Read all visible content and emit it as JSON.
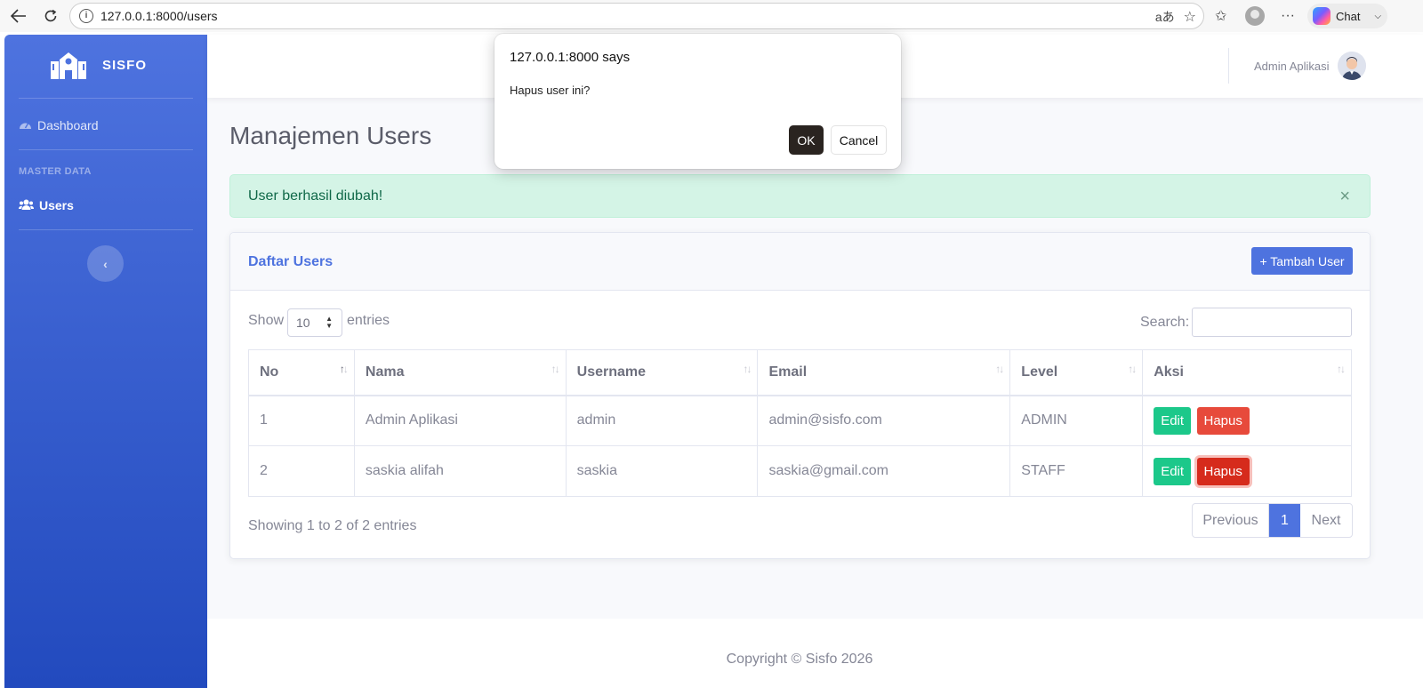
{
  "browser": {
    "url": "127.0.0.1:8000/users",
    "chat_label": "Chat"
  },
  "sidebar": {
    "brand": "SISFO",
    "items": [
      {
        "label": "Dashboard",
        "icon": "tachometer-icon"
      },
      {
        "label": "Users",
        "icon": "users-icon"
      }
    ],
    "heading": "MASTER DATA",
    "toggle_symbol": "‹"
  },
  "topbar": {
    "user_name": "Admin Aplikasi"
  },
  "page": {
    "title": "Manajemen Users"
  },
  "alert": {
    "message": "User berhasil diubah!",
    "close": "×"
  },
  "card": {
    "title": "Daftar Users",
    "add_button": "+ Tambah User",
    "show_label": "Show",
    "entries_select": "10",
    "entries_label": "entries",
    "search_label": "Search:",
    "search_value": "",
    "columns": [
      "No",
      "Nama",
      "Username",
      "Email",
      "Level",
      "Aksi"
    ],
    "rows": [
      {
        "no": "1",
        "nama": "Admin Aplikasi",
        "username": "admin",
        "email": "admin@sisfo.com",
        "level": "ADMIN",
        "edit": "Edit",
        "hapus": "Hapus"
      },
      {
        "no": "2",
        "nama": "saskia alifah",
        "username": "saskia",
        "email": "saskia@gmail.com",
        "level": "STAFF",
        "edit": "Edit",
        "hapus": "Hapus"
      }
    ],
    "info": "Showing 1 to 2 of 2 entries",
    "pagination": {
      "previous": "Previous",
      "current": "1",
      "next": "Next"
    }
  },
  "footer": {
    "text": "Copyright © Sisfo 2026"
  },
  "dialog": {
    "title": "127.0.0.1:8000 says",
    "message": "Hapus user ini?",
    "ok": "OK",
    "cancel": "Cancel"
  },
  "colors": {
    "primary": "#4e73df",
    "success": "#1cc88a",
    "danger": "#e74a3b"
  }
}
